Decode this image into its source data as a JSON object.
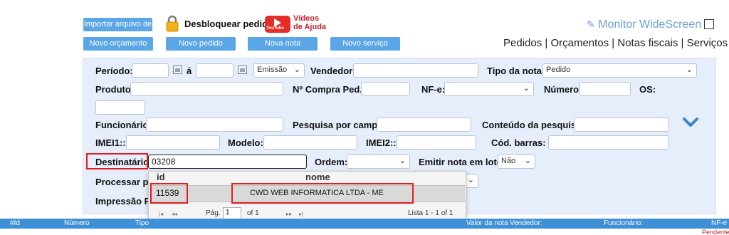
{
  "toolbar": {
    "import_label": "Importar arquivo de",
    "unlock_label": "Desbloquear pedidos",
    "videos_line1": "Vídeos",
    "videos_line2": "de Ajuda",
    "youtube_text": "YouTube",
    "monitor_label": "Monitor WideScreen",
    "new_budget": "Novo orçamento",
    "new_order": "Novo pedido",
    "new_invoice": "Nova nota",
    "new_service": "Novo serviço",
    "nav": "Pedidos | Orçamentos | Notas fiscais | Serviços"
  },
  "filters": {
    "periodo": "Período:",
    "a": "á",
    "emissao": "Emissão",
    "vendedor": "Vendedor:",
    "tipo_nota": "Tipo da nota:",
    "tipo_nota_value": "Pedido",
    "produto": "Produto:",
    "compra": "Nº Compra Ped.:",
    "nfe": "NF-e:",
    "numero": "Número:",
    "os": "OS:",
    "funcionario": "Funcionário:",
    "pesquisa_campo": "Pesquisa por campo:",
    "conteudo": "Conteúdo da pesquisa:",
    "imei1": "IMEI1::",
    "modelo": "Modelo:",
    "imei2": "IMEI2::",
    "cod_barras": "Cód. barras:",
    "destinatario": "Destinatário:",
    "destinatario_value": "03208",
    "ordem": "Ordem:",
    "emitir_lote": "Emitir nota em lote:",
    "emitir_lote_value": "Não",
    "processar": "Processar pe",
    "impressao": "Impressão PD"
  },
  "autocomplete": {
    "col_id": "id",
    "col_nome": "nome",
    "row_id": "11539",
    "row_nome": "CWD WEB INFORMATICA LTDA - ME",
    "page_label": "Pág.",
    "page_value": "1",
    "of_label": "of 1",
    "list_info": "Lista 1 - 1 of 1",
    "first_icon": "|◂",
    "prev_icon": "◂◂",
    "next_icon": "▸▸",
    "last_icon": "▸|"
  },
  "table": {
    "headers": {
      "id": "#Id",
      "numero": "Número",
      "tipo": "Tipo",
      "valor": "Valor da nota",
      "vendedor": "Vendedor:",
      "funcionario": "Funcionário:",
      "nfe": "NF-e"
    },
    "status": "Pendente"
  },
  "colors": {
    "button_blue": "#5aa6e6",
    "panel_bg": "#e6eefb",
    "highlight_red": "#e02020",
    "header_blue": "#3d8fd6"
  }
}
